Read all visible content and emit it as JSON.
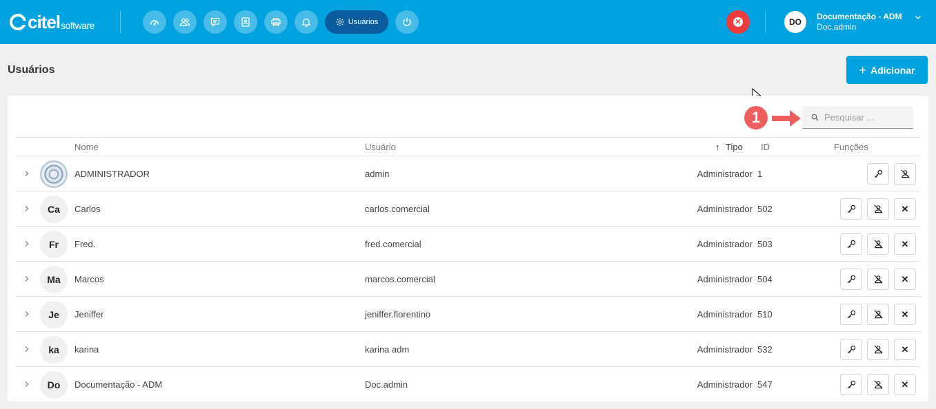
{
  "brand": {
    "name": "citel",
    "suffix": "software"
  },
  "nav": {
    "icons": [
      "dashboard-icon",
      "users-icon",
      "chat-icon",
      "contacts-icon",
      "printer-icon",
      "bell-icon"
    ],
    "active_label": "Usuários",
    "active_icon": "gear-icon",
    "power_icon": "power-icon"
  },
  "user": {
    "initials": "DO",
    "name": "Documentação - ADM",
    "login": "Doc.admin"
  },
  "page": {
    "title": "Usuários",
    "add_label": "Adicionar",
    "callout_number": "1"
  },
  "search": {
    "placeholder": "Pesquisar ..."
  },
  "table": {
    "headers": {
      "nome": "Nome",
      "usuario": "Usuário",
      "tipo": "Tipo",
      "id": "ID",
      "funcoes": "Funções"
    },
    "sort": {
      "column": "tipo",
      "direction": "asc"
    },
    "rows": [
      {
        "avatar": "",
        "avatar_is_image": true,
        "nome": "ADMINISTRADOR",
        "usuario": "admin",
        "tipo": "Administrador",
        "id": "1",
        "deletable": false
      },
      {
        "avatar": "Ca",
        "nome": "Carlos",
        "usuario": "carlos.comercial",
        "tipo": "Administrador",
        "id": "502",
        "deletable": true
      },
      {
        "avatar": "Fr",
        "nome": "Fred.",
        "usuario": "fred.comercial",
        "tipo": "Administrador",
        "id": "503",
        "deletable": true
      },
      {
        "avatar": "Ma",
        "nome": "Marcos",
        "usuario": "marcos.comercial",
        "tipo": "Administrador",
        "id": "504",
        "deletable": true
      },
      {
        "avatar": "Je",
        "nome": "Jeniffer",
        "usuario": "jeniffer.florentino",
        "tipo": "Administrador",
        "id": "510",
        "deletable": true
      },
      {
        "avatar": "ka",
        "nome": "karina",
        "usuario": "karina adm",
        "tipo": "Administrador",
        "id": "532",
        "deletable": true
      },
      {
        "avatar": "Do",
        "nome": "Documentação - ADM",
        "usuario": "Doc.admin",
        "tipo": "Administrador",
        "id": "547",
        "deletable": true
      }
    ]
  },
  "colors": {
    "primary": "#00a3e0",
    "nav_active": "#0a5c9e",
    "danger": "#ef3b3b",
    "callout": "#ef5f5f"
  }
}
